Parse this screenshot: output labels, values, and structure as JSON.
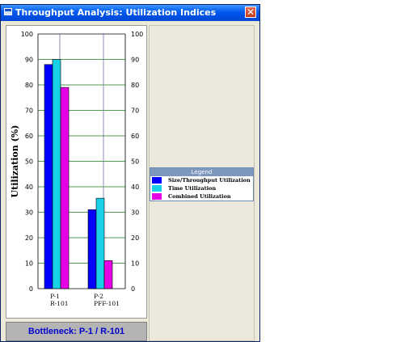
{
  "window": {
    "title": "Throughput Analysis: Utilization Indices",
    "close_glyph": "✕"
  },
  "status": {
    "text": "Bottleneck: P-1 / R-101"
  },
  "legend": {
    "title": "Legend",
    "items": [
      {
        "label": "Size/Throughput Utilization",
        "color": "#0000ff"
      },
      {
        "label": "Time Utilization",
        "color": "#19d1e6"
      },
      {
        "label": "Combined Utilization",
        "color": "#e600e6"
      }
    ]
  },
  "chart_data": {
    "type": "bar",
    "ylabel": "Utilization (%)",
    "ylim": [
      0,
      100
    ],
    "yticks": [
      "0",
      "10",
      "20",
      "30",
      "40",
      "50",
      "60",
      "70",
      "80",
      "90",
      "100"
    ],
    "categories": [
      {
        "line1": "P-1",
        "line2": "R-101"
      },
      {
        "line1": "P-2",
        "line2": "PFF-101"
      }
    ],
    "series": [
      {
        "name": "Size/Throughput Utilization",
        "color": "#0000ff",
        "values": [
          88,
          31
        ]
      },
      {
        "name": "Time Utilization",
        "color": "#19d1e6",
        "values": [
          90,
          35.5
        ]
      },
      {
        "name": "Combined Utilization",
        "color": "#e600e6",
        "values": [
          79,
          11
        ]
      }
    ],
    "grid": true,
    "legend": "right-panel"
  }
}
